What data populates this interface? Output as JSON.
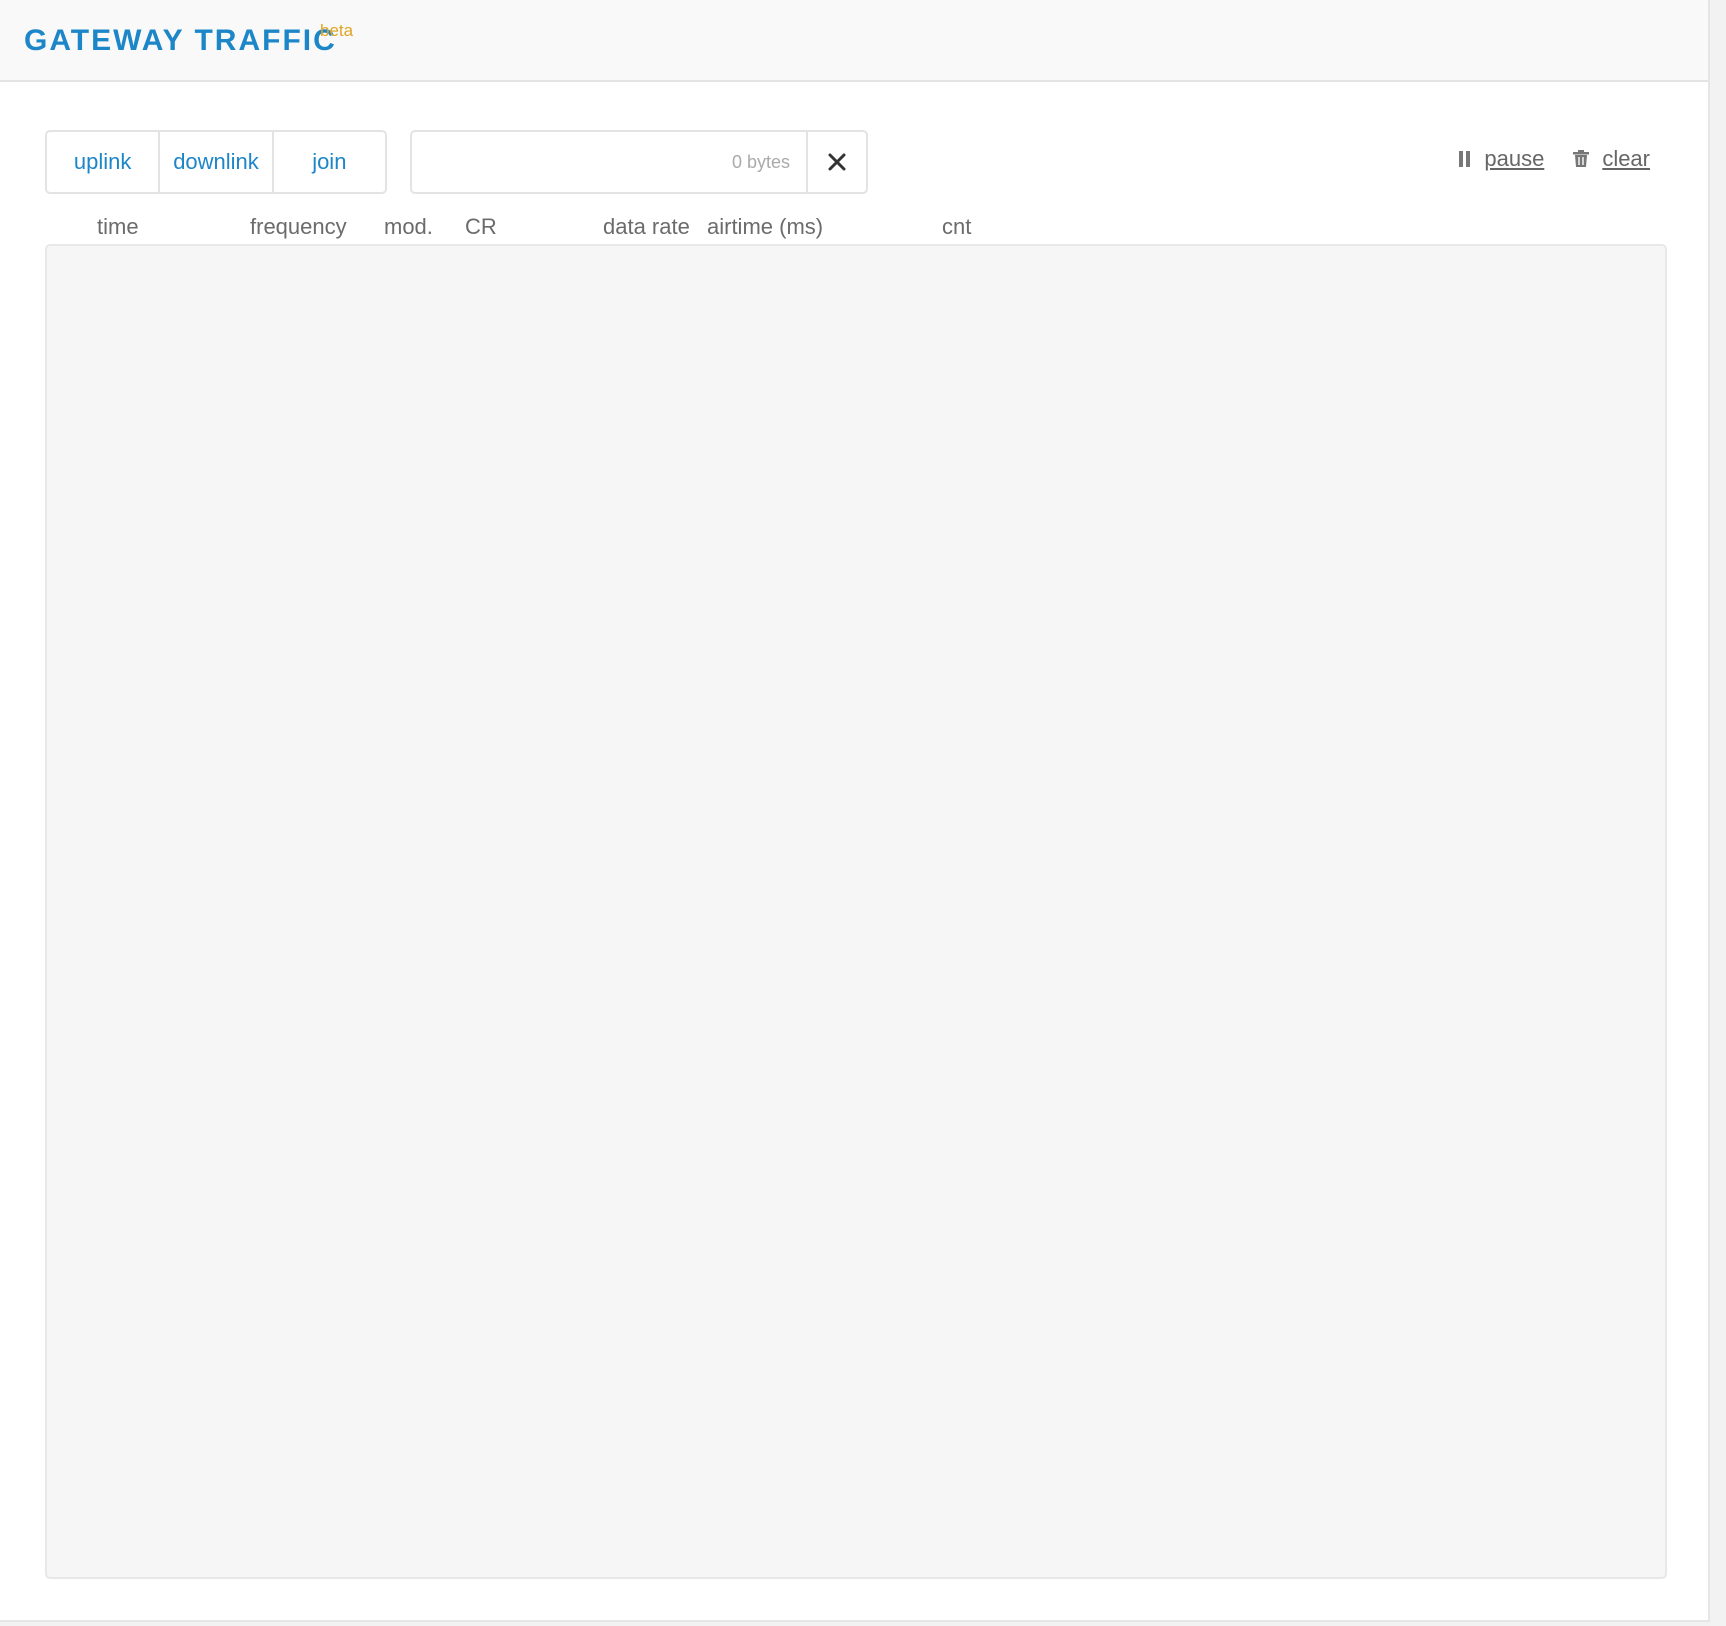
{
  "header": {
    "title": "GATEWAY TRAFFIC",
    "badge": "beta"
  },
  "filters": [
    {
      "label": "uplink"
    },
    {
      "label": "downlink"
    },
    {
      "label": "join"
    }
  ],
  "search": {
    "value": "",
    "placeholder": "0 bytes"
  },
  "actions": {
    "pause_label": "pause",
    "clear_label": "clear"
  },
  "columns": [
    "time",
    "frequency",
    "mod.",
    "CR",
    "data rate",
    "airtime (ms)",
    "cnt"
  ],
  "colors": {
    "accent": "#1c86c8",
    "badge": "#e0a422",
    "muted_text": "#6b6b6b"
  },
  "icons": {
    "clear_search": "close-icon",
    "pause": "pause-icon",
    "clear": "trash-icon"
  }
}
